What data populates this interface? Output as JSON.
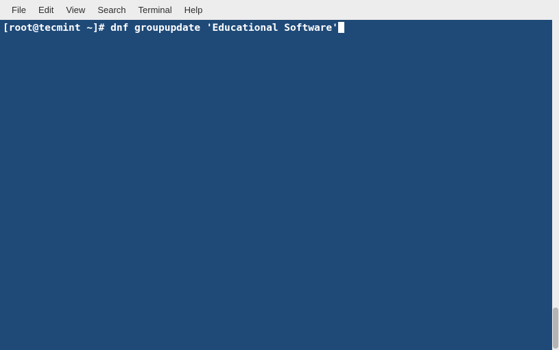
{
  "menubar": {
    "items": [
      "File",
      "Edit",
      "View",
      "Search",
      "Terminal",
      "Help"
    ]
  },
  "terminal": {
    "prompt": "[root@tecmint ~]# ",
    "command": "dnf groupupdate 'Educational Software'",
    "background_color": "#1f4a78",
    "text_color": "#ffffff"
  }
}
